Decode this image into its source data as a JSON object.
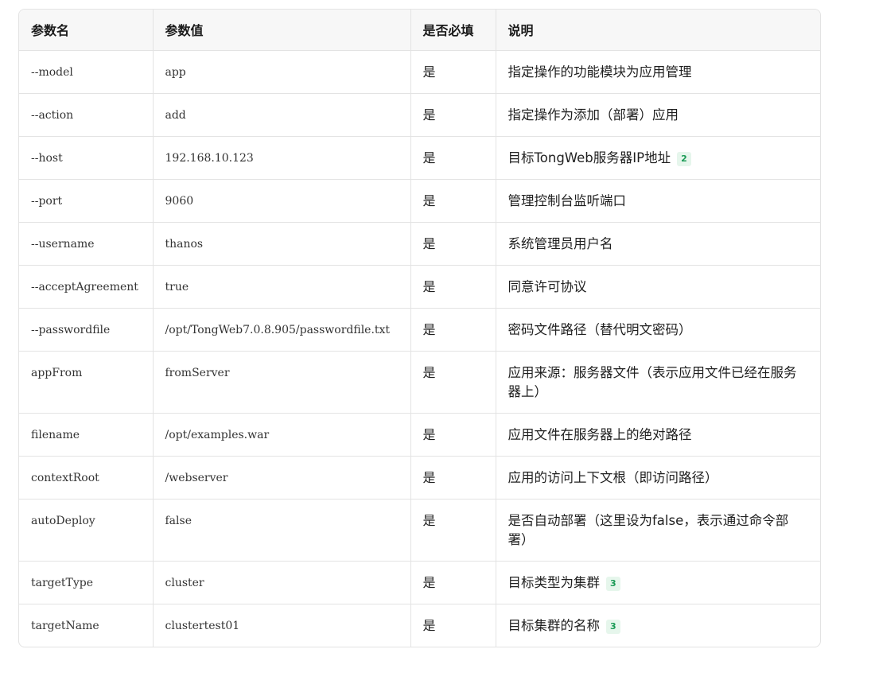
{
  "table": {
    "headers": [
      "参数名",
      "参数值",
      "是否必填",
      "说明"
    ],
    "rows": [
      {
        "name": "--model",
        "value": "app",
        "required": "是",
        "desc": "指定操作的功能模块为应用管理",
        "ref": ""
      },
      {
        "name": "--action",
        "value": "add",
        "required": "是",
        "desc": "指定操作为添加（部署）应用",
        "ref": ""
      },
      {
        "name": "--host",
        "value": "192.168.10.123",
        "required": "是",
        "desc": "目标TongWeb服务器IP地址",
        "ref": "2"
      },
      {
        "name": "--port",
        "value": "9060",
        "required": "是",
        "desc": "管理控制台监听端口",
        "ref": ""
      },
      {
        "name": "--username",
        "value": "thanos",
        "required": "是",
        "desc": "系统管理员用户名",
        "ref": ""
      },
      {
        "name": "--acceptAgreement",
        "value": "true",
        "required": "是",
        "desc": "同意许可协议",
        "ref": ""
      },
      {
        "name": "--passwordfile",
        "value": "/opt/TongWeb7.0.8.905/passwordfile.txt",
        "required": "是",
        "desc": "密码文件路径（替代明文密码）",
        "ref": ""
      },
      {
        "name": "appFrom",
        "value": "fromServer",
        "required": "是",
        "desc": "应用来源：服务器文件（表示应用文件已经在服务器上）",
        "ref": ""
      },
      {
        "name": "filename",
        "value": "/opt/examples.war",
        "required": "是",
        "desc": "应用文件在服务器上的绝对路径",
        "ref": ""
      },
      {
        "name": "contextRoot",
        "value": "/webserver",
        "required": "是",
        "desc": "应用的访问上下文根（即访问路径）",
        "ref": ""
      },
      {
        "name": "autoDeploy",
        "value": "false",
        "required": "是",
        "desc": "是否自动部署（这里设为false，表示通过命令部署）",
        "ref": ""
      },
      {
        "name": "targetType",
        "value": "cluster",
        "required": "是",
        "desc": "目标类型为集群",
        "ref": "3"
      },
      {
        "name": "targetName",
        "value": "clustertest01",
        "required": "是",
        "desc": "目标集群的名称",
        "ref": "3"
      }
    ]
  }
}
